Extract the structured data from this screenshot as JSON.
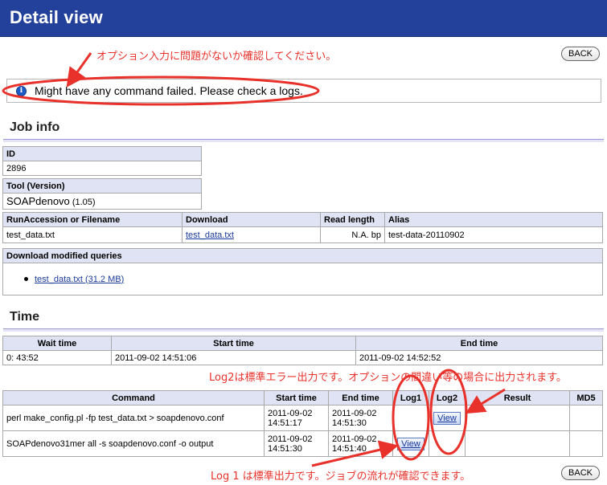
{
  "header": {
    "title": "Detail view"
  },
  "back_label": "BACK",
  "annotations": {
    "top": "オプション入力に問題がないか確認してください。",
    "log2": "Log2は標準エラー出力です。オプションの間違い等の場合に出力されます。",
    "log1": "Log 1 は標準出力です。ジョブの流れが確認できます。"
  },
  "message": {
    "icon": "info-icon",
    "text": "Might have any command failed. Please check a logs."
  },
  "job_info": {
    "title": "Job info",
    "id_label": "ID",
    "id_value": "2896",
    "tool_label": "Tool (Version)",
    "tool_name": "SOAPdenovo",
    "tool_version": "(1.05)",
    "file_headers": [
      "RunAccession or Filename",
      "Download",
      "Read length",
      "Alias"
    ],
    "file_row": [
      "test_data.txt",
      "test_data.txt",
      "N.A. bp",
      "test-data-20110902"
    ],
    "download_label": "Download modified queries",
    "download_item": "test_data.txt (31.2 MB)"
  },
  "time": {
    "title": "Time",
    "headers": [
      "Wait time",
      "Start time",
      "End time"
    ],
    "row": [
      "0: 43:52",
      "2011-09-02 14:51:06",
      "2011-09-02 14:52:52"
    ]
  },
  "commands": {
    "headers": [
      "Command",
      "Start time",
      "End time",
      "Log1",
      "Log2",
      "Result",
      "MD5"
    ],
    "rows": [
      {
        "command": "perl make_config.pl -fp test_data.txt > soapdenovo.conf",
        "start_date": "2011-09-02",
        "start_time": "14:51:17",
        "end_date": "2011-09-02",
        "end_time": "14:51:30",
        "log1": "",
        "log2": "View"
      },
      {
        "command": "SOAPdenovo31mer all -s soapdenovo.conf -o output",
        "start_date": "2011-09-02",
        "start_time": "14:51:30",
        "end_date": "2011-09-02",
        "end_time": "14:51:40",
        "log1": "View",
        "log2": ""
      }
    ]
  },
  "colors": {
    "header_bg": "#23409a",
    "annotation_red": "#e8312a",
    "table_header_bg": "#dfe3f3"
  }
}
